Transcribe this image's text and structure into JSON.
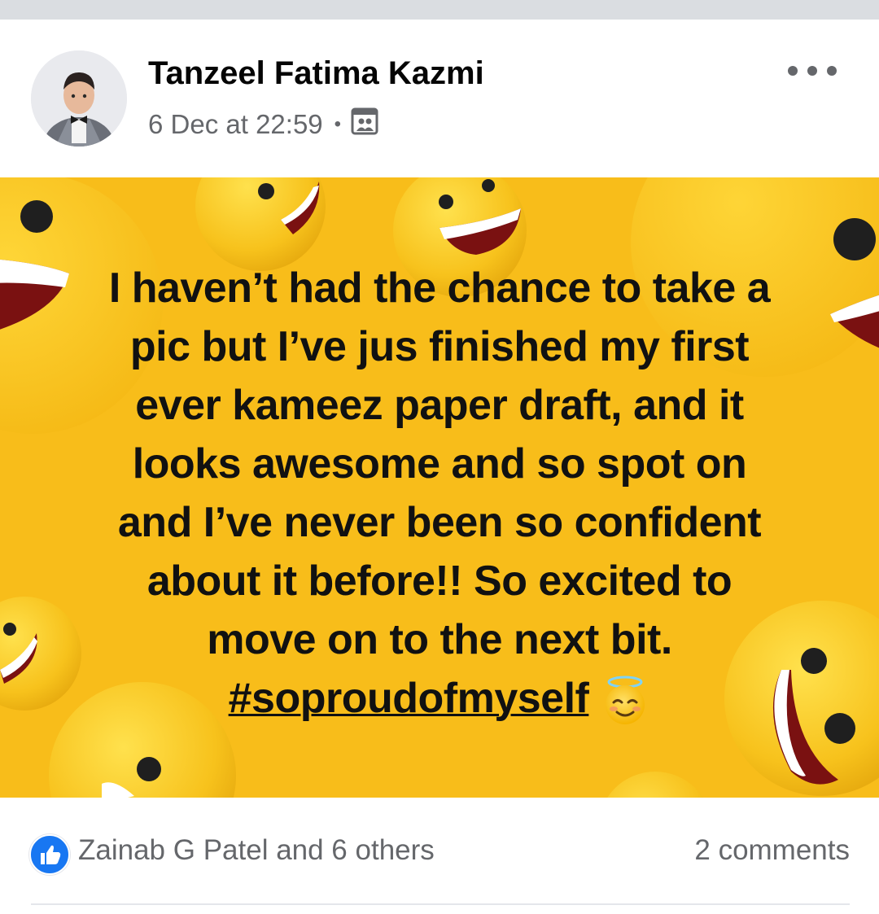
{
  "post": {
    "author": "Tanzeel Fatima Kazmi",
    "timestamp": "6 Dec at 22:59",
    "separator": "•",
    "audience_icon": "friends-icon",
    "more_icon": "more-options-icon",
    "background_color": "#f8bd1a",
    "text_lines": [
      "I haven’t had the chance to take a",
      "pic but I’ve jus finished my first",
      "ever kameez paper draft, and it",
      "looks awesome and so spot on",
      "and I’ve never been so confident",
      "about it before!! So excited to",
      "move on to the next bit."
    ],
    "hashtag": "#soproudofmyself",
    "emoji": "smiling-face-with-halo-icon"
  },
  "reactions": {
    "icon": "like-icon",
    "summary": "Zainab G Patel and 6 others",
    "comments": "2 comments"
  },
  "colors": {
    "like_blue": "#1877f2",
    "secondary_text": "#65676b"
  }
}
